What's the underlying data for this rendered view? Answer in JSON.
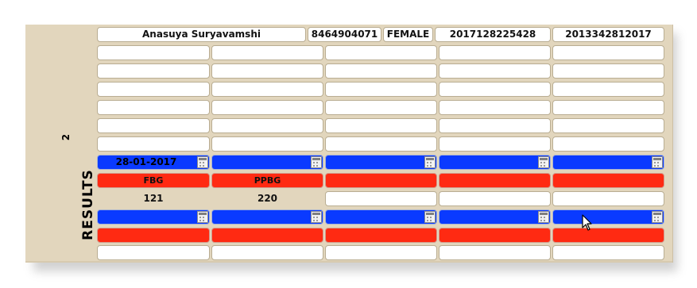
{
  "patient": {
    "name": "Anasuya Suryavamshi",
    "phone": "8464904071",
    "gender": "FEMALE",
    "id_a": "2017128225428",
    "id_b": "2013342812017"
  },
  "group_number": "2",
  "section_label": "RESULTS",
  "result_row_1": {
    "date_1": "28-01-2017",
    "tests": [
      "FBG",
      "PPBG"
    ],
    "values": [
      "121",
      "220"
    ]
  },
  "colors": {
    "blue": "#0a3aff",
    "red": "#ff2a12",
    "panel": "#e2d6bd"
  },
  "icons": {
    "calendar": "calendar-icon",
    "cursor": "mouse-pointer-icon"
  }
}
